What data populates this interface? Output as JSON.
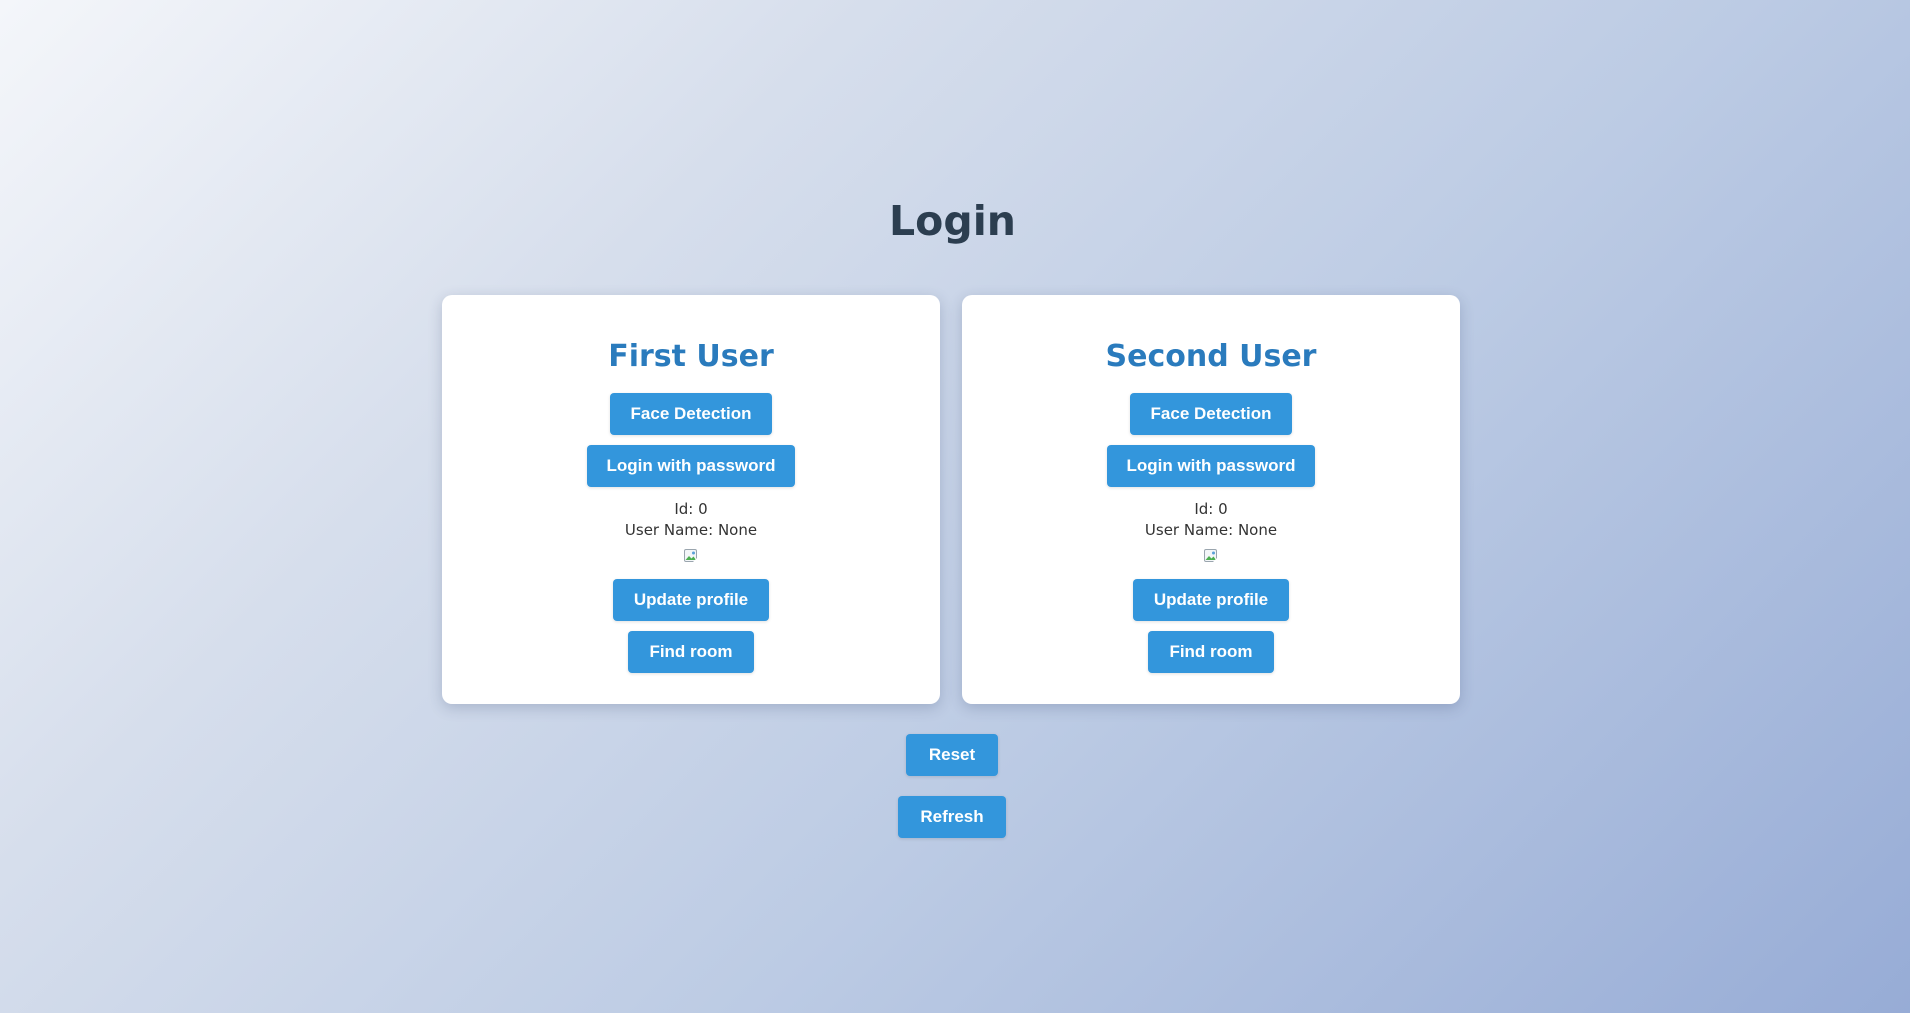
{
  "page": {
    "title": "Login"
  },
  "users": [
    {
      "title": "First User",
      "face_detection_label": "Face Detection",
      "login_password_label": "Login with password",
      "id_text": "Id: 0",
      "user_name_text": "User Name: None",
      "avatar_icon": "broken-image-icon",
      "update_profile_label": "Update profile",
      "find_room_label": "Find room"
    },
    {
      "title": "Second User",
      "face_detection_label": "Face Detection",
      "login_password_label": "Login with password",
      "id_text": "Id: 0",
      "user_name_text": "User Name: None",
      "avatar_icon": "broken-image-icon",
      "update_profile_label": "Update profile",
      "find_room_label": "Find room"
    }
  ],
  "actions": {
    "reset_label": "Reset",
    "refresh_label": "Refresh"
  },
  "colors": {
    "accent": "#3396dc",
    "heading": "#2c3e50",
    "card_title": "#2a7bbd"
  }
}
